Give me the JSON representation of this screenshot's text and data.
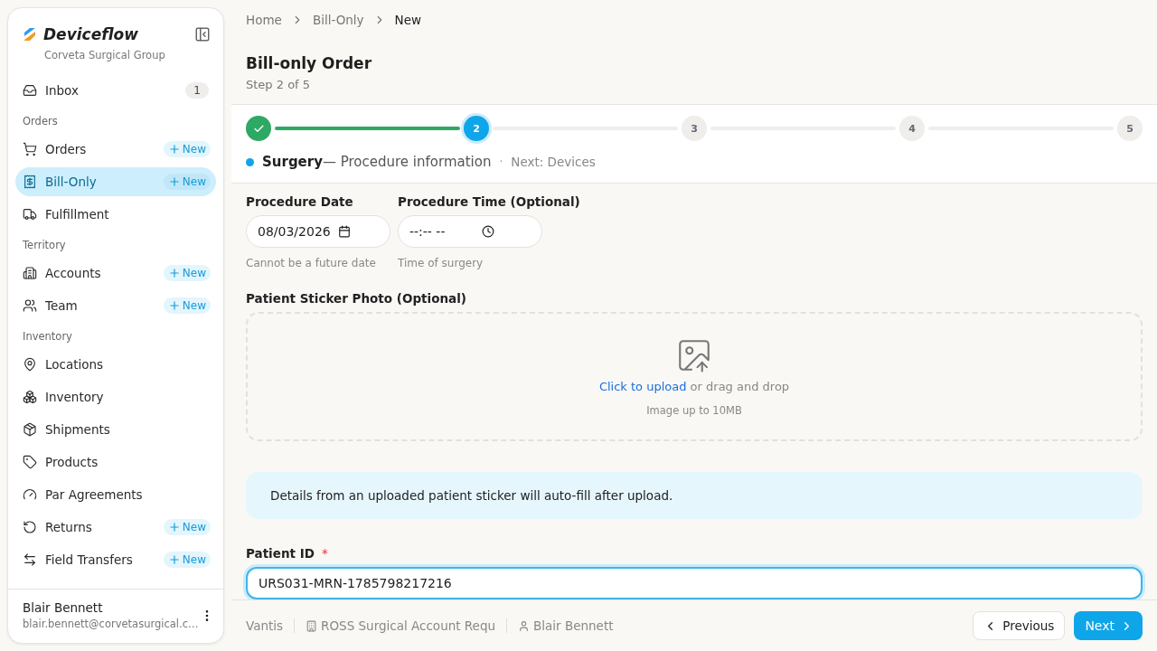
{
  "sidebar": {
    "brand": "Deviceflow",
    "org": "Corveta Surgical Group",
    "sections": [
      {
        "items": [
          {
            "label": "Inbox",
            "badge": "1",
            "selected": false
          }
        ]
      },
      {
        "heading": "Orders",
        "items": [
          {
            "label": "Orders",
            "action": "New",
            "selected": false
          },
          {
            "label": "Bill-Only",
            "action": "New",
            "selected": true
          },
          {
            "label": "Fulfillment",
            "selected": false
          }
        ]
      },
      {
        "heading": "Territory",
        "items": [
          {
            "label": "Accounts",
            "action": "New",
            "selected": false
          },
          {
            "label": "Team",
            "action": "New",
            "selected": false
          }
        ]
      },
      {
        "heading": "Inventory",
        "items": [
          {
            "label": "Locations",
            "selected": false
          },
          {
            "label": "Inventory",
            "selected": false
          },
          {
            "label": "Shipments",
            "selected": false
          },
          {
            "label": "Products",
            "selected": false
          },
          {
            "label": "Par Agreements",
            "selected": false
          },
          {
            "label": "Returns",
            "action": "New",
            "selected": false
          },
          {
            "label": "Field Transfers",
            "action": "New",
            "selected": false
          }
        ]
      }
    ],
    "user": {
      "name": "Blair Bennett",
      "email": "blair.bennett@corvetasurgical.c…"
    }
  },
  "breadcrumb": [
    "Home",
    "Bill-Only",
    "New"
  ],
  "page": {
    "title": "Bill-only Order",
    "subtitle": "Step 2 of 5"
  },
  "stepper": {
    "steps": [
      {
        "done": true,
        "selected": false
      },
      {
        "label": "2",
        "done": false,
        "selected": true
      },
      {
        "label": "3",
        "done": false,
        "selected": false
      },
      {
        "label": "4",
        "done": false,
        "selected": false
      },
      {
        "label": "5",
        "done": false,
        "selected": false
      }
    ],
    "current_title": "Surgery",
    "current_detail": "— Procedure information",
    "separator": "·",
    "next": "Next: Devices"
  },
  "form": {
    "date": {
      "label": "Procedure Date",
      "value": "08/03/2026",
      "hint": "Cannot be a future date"
    },
    "time": {
      "label": "Procedure Time (Optional)",
      "value": "--:-- --",
      "hint": "Time of surgery"
    },
    "upload": {
      "label": "Patient Sticker Photo (Optional)",
      "link": "Click to upload",
      "text": " or drag and drop",
      "hint": "Image up to 10MB"
    },
    "info": "Details from an uploaded patient sticker will auto-fill after upload.",
    "patient_id": {
      "label": "Patient ID",
      "required": "*",
      "value": "URS031-MRN-1785798217216"
    }
  },
  "footer": {
    "vendor": "Vantis",
    "account": "ROSS Surgical Account Requ",
    "rep": "Blair Bennett",
    "buttons": {
      "previous": "Previous",
      "next": "Next"
    }
  }
}
